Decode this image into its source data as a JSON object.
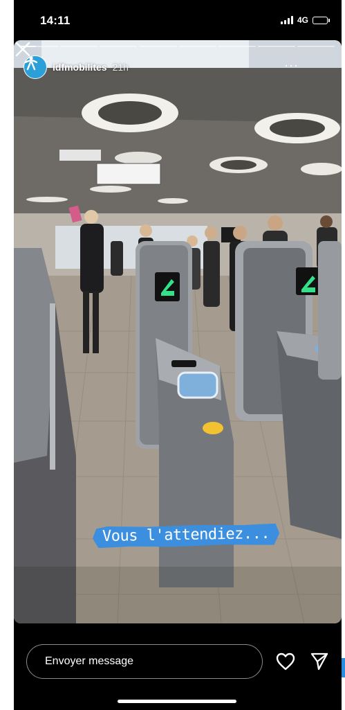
{
  "status_bar": {
    "time": "14:11",
    "network": "4G",
    "icons": [
      "signal-icon",
      "battery-icon"
    ]
  },
  "story": {
    "username": "idfmobilites",
    "posted_ago": "21h",
    "more_label": "···",
    "progress_segments": 8,
    "active_segment": 1,
    "active_progress": 0.4,
    "caption": "Vous l'attendiez...",
    "caption_color": "#3b8fde",
    "icons": [
      "person-logo-icon",
      "close-icon"
    ]
  },
  "bottom_bar": {
    "message_placeholder": "Envoyer message",
    "icons": [
      "heart-icon",
      "send-icon"
    ]
  },
  "colors": {
    "background": "#000000",
    "accent": "#3b8fde",
    "gate_signal": "#35e08a"
  }
}
